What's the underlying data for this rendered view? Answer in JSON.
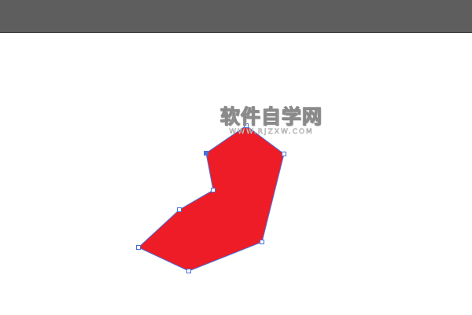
{
  "toolbar": {
    "background_color": "#5e5e5e"
  },
  "artboard": {
    "background_color": "#ffffff"
  },
  "watermark": {
    "main_text": "软件自学网",
    "url_text": "WWW.RJZXW.COM"
  },
  "shape": {
    "fill_color": "#ee1c26",
    "path_color": "#4a6fd8",
    "anchor_points_visible": true,
    "selected": true
  }
}
